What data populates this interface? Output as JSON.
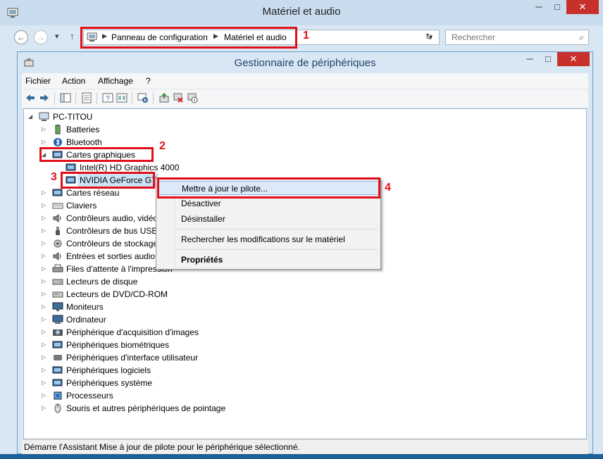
{
  "outer_window": {
    "title": "Matériel et audio",
    "buttons": {
      "minimize": "─",
      "maximize": "□",
      "close": "✕"
    }
  },
  "address_bar": {
    "crumbs": [
      "Panneau de configuration",
      "Matériel et audio"
    ],
    "search_placeholder": "Rechercher"
  },
  "inner_window": {
    "title": "Gestionnaire de périphériques",
    "buttons": {
      "minimize": "─",
      "maximize": "□",
      "close": "✕"
    }
  },
  "menu": [
    "Fichier",
    "Action",
    "Affichage",
    "?"
  ],
  "tree": {
    "root": "PC-TITOU",
    "items": [
      "Batteries",
      "Bluetooth",
      "Cartes graphiques",
      "Intel(R) HD Graphics 4000",
      "NVIDIA GeForce GT",
      "Cartes réseau",
      "Claviers",
      "Contrôleurs audio, vidéo",
      "Contrôleurs de bus USB",
      "Contrôleurs de stockage",
      "Entrées et sorties audio",
      "Files d'attente à l'impression",
      "Lecteurs de disque",
      "Lecteurs de DVD/CD-ROM",
      "Moniteurs",
      "Ordinateur",
      "Périphérique d'acquisition d'images",
      "Périphériques biométriques",
      "Périphériques d'interface utilisateur",
      "Périphériques logiciels",
      "Périphériques système",
      "Processeurs",
      "Souris et autres périphériques de pointage"
    ]
  },
  "context_menu": {
    "update": "Mettre à jour le pilote...",
    "disable": "Désactiver",
    "uninstall": "Désinstaller",
    "scan": "Rechercher les modifications sur le matériel",
    "properties": "Propriétés"
  },
  "status_text": "Démarre l'Assistant Mise à jour de pilote pour le périphérique sélectionné.",
  "annotations": [
    "1",
    "2",
    "3",
    "4"
  ],
  "colors": {
    "annotation": "#e0101b",
    "highlight": "#dbe9f8"
  }
}
